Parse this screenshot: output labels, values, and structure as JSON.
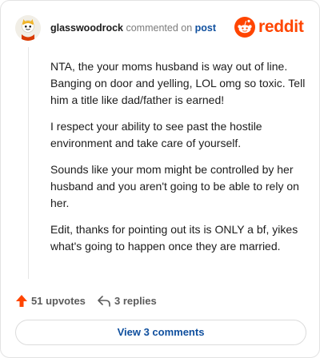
{
  "colors": {
    "brand": "#ff4500",
    "link": "#0f4f9e",
    "muted": "#7c7c7c"
  },
  "comment": {
    "username": "glasswoodrock",
    "action_text": "commented on",
    "post_link": "post",
    "brand_name": "reddit",
    "avatar_icon": "snoo-avatar-icon",
    "paragraphs": [
      "NTA, the your moms husband is way out of line. Banging on door and yelling, LOL omg so toxic. Tell him a title like dad/father is earned!",
      "I respect your ability to see past the hostile environment and take care of yourself.",
      "Sounds like your mom might be controlled by her husband and you aren't going to be able to rely on her.",
      "Edit, thanks for pointing out its is ONLY a bf, yikes what's going to happen once they are married."
    ],
    "upvotes_label": "51 upvotes",
    "replies_label": "3 replies",
    "view_comments_label": "View 3 comments"
  }
}
